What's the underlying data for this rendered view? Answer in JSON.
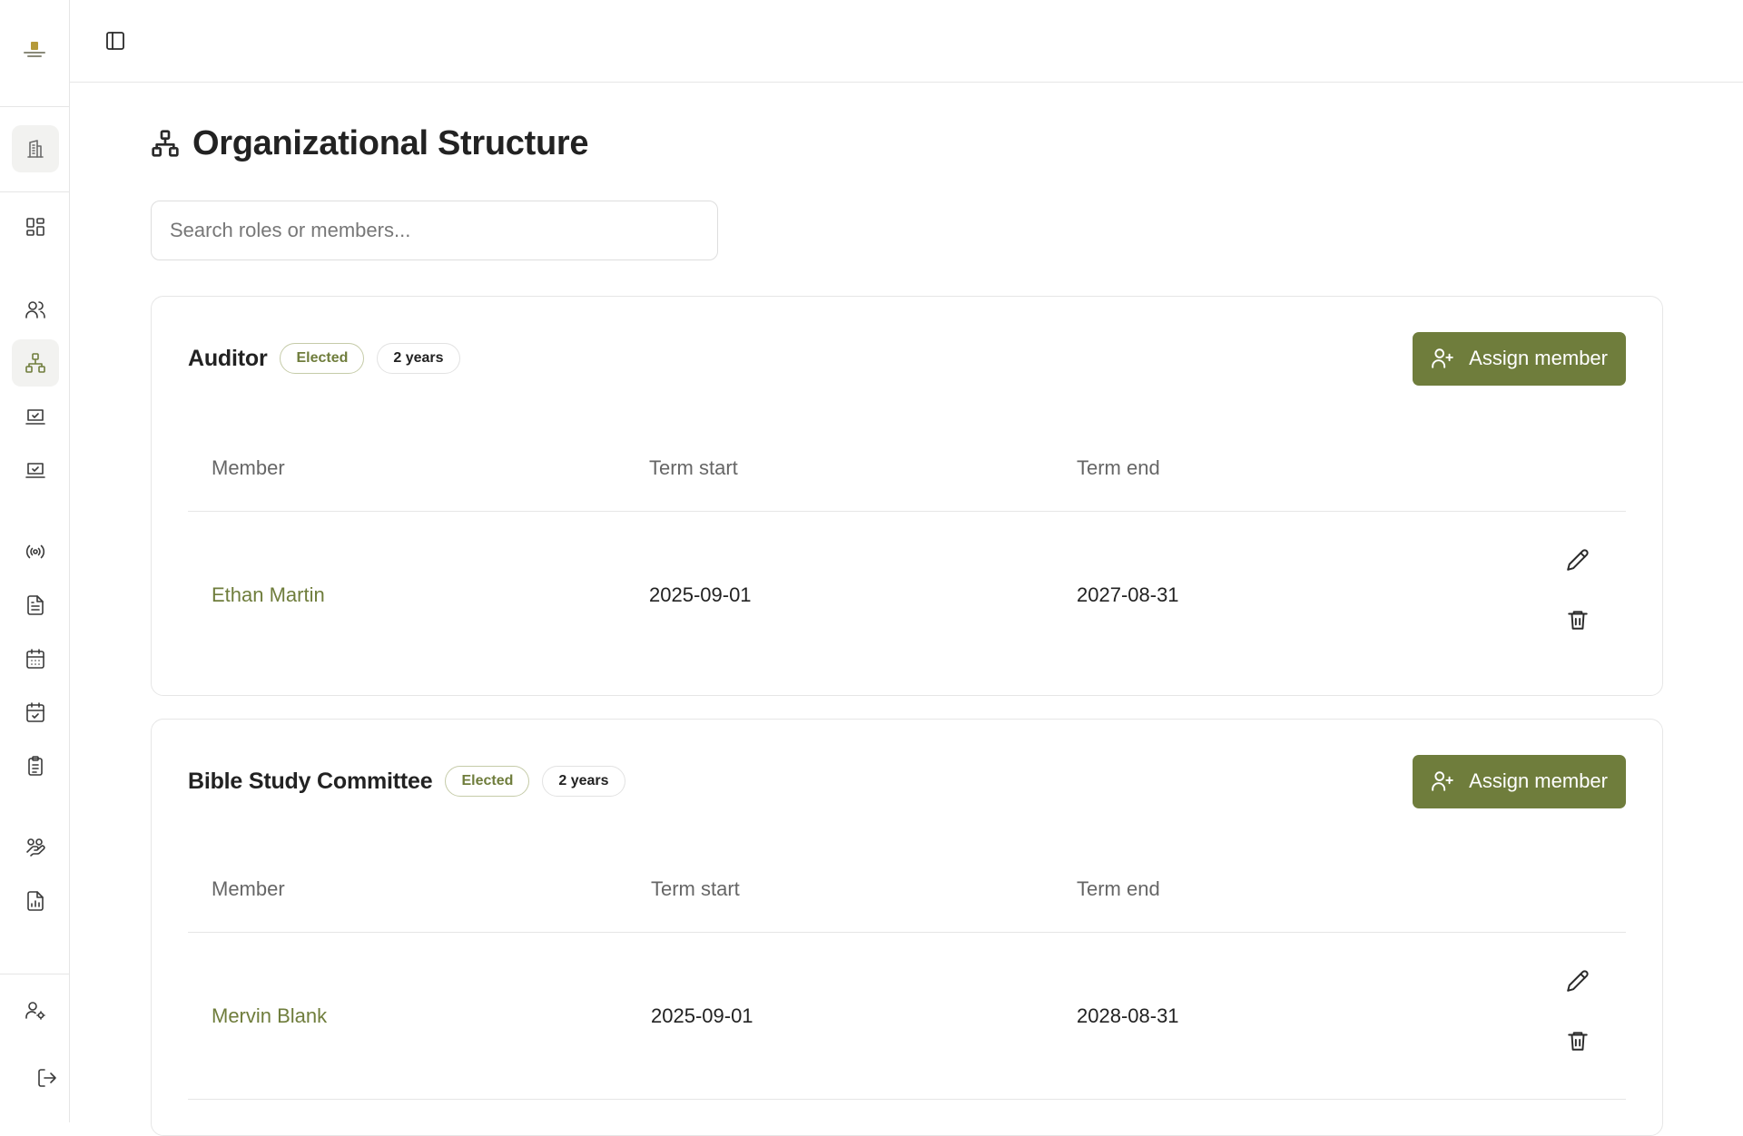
{
  "page": {
    "title": "Organizational Structure",
    "title_icon": "sitemap-icon"
  },
  "search": {
    "placeholder": "Search roles or members..."
  },
  "sidebar": {
    "logo": "organization-logo",
    "items": [
      {
        "icon": "building-icon",
        "name": "organization"
      },
      {
        "icon": "dashboard-icon",
        "name": "dashboard"
      },
      {
        "icon": "users-icon",
        "name": "members"
      },
      {
        "icon": "sitemap-icon",
        "name": "structure",
        "active": true
      },
      {
        "icon": "laptop-check-icon",
        "name": "tasks"
      },
      {
        "icon": "laptop-check-icon",
        "name": "approvals"
      },
      {
        "icon": "broadcast-icon",
        "name": "broadcast"
      },
      {
        "icon": "document-icon",
        "name": "documents"
      },
      {
        "icon": "calendar-icon",
        "name": "calendar"
      },
      {
        "icon": "calendar-check-icon",
        "name": "attendance"
      },
      {
        "icon": "clipboard-list-icon",
        "name": "reports-list"
      },
      {
        "icon": "hand-coins-icon",
        "name": "donations"
      },
      {
        "icon": "chart-file-icon",
        "name": "analytics"
      },
      {
        "icon": "user-settings-icon",
        "name": "account-settings"
      },
      {
        "icon": "logout-icon",
        "name": "logout"
      }
    ]
  },
  "accent_color": "#6f7d3c",
  "roles": [
    {
      "name": "Auditor",
      "type_badge": "Elected",
      "term_badge": "2 years",
      "assign_label": "Assign member",
      "columns": {
        "member": "Member",
        "term_start": "Term start",
        "term_end": "Term end"
      },
      "rows": [
        {
          "member": "Ethan Martin",
          "term_start": "2025-09-01",
          "term_end": "2027-08-31"
        }
      ]
    },
    {
      "name": "Bible Study Committee",
      "type_badge": "Elected",
      "term_badge": "2 years",
      "assign_label": "Assign member",
      "columns": {
        "member": "Member",
        "term_start": "Term start",
        "term_end": "Term end"
      },
      "rows": [
        {
          "member": "Mervin Blank",
          "term_start": "2025-09-01",
          "term_end": "2028-08-31"
        }
      ]
    }
  ]
}
